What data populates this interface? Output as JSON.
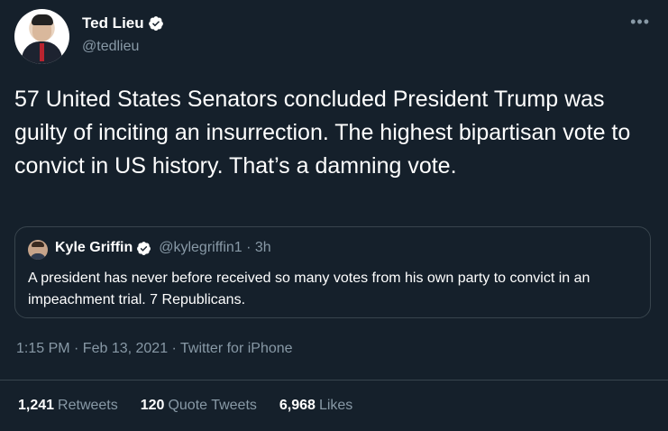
{
  "author": {
    "name": "Ted Lieu",
    "handle": "@tedlieu"
  },
  "tweet": {
    "text": "57 United States Senators concluded President Trump was guilty of inciting an insurrection. The highest bipartisan vote to convict in US history. That’s a damning vote."
  },
  "quoted": {
    "name": "Kyle Griffin",
    "meta": "@kylegriffin1 · 3h",
    "text": "A president has never before received so many votes from his own party to convict in an impeachment trial. 7 Republicans."
  },
  "meta": {
    "timestamp": "1:15 PM · Feb 13, 2021 · Twitter for iPhone"
  },
  "stats": {
    "retweets_count": "1,241",
    "retweets_label": "Retweets",
    "quote_count": "120",
    "quote_label": "Quote Tweets",
    "likes_count": "6,968",
    "likes_label": "Likes"
  },
  "colors": {
    "background": "#15202b",
    "secondary_text": "#8899a6",
    "verified_blue": "#ffffff",
    "border": "#38444d"
  },
  "icons": {
    "verified": "verified-badge-icon",
    "more": "more-options-icon"
  }
}
